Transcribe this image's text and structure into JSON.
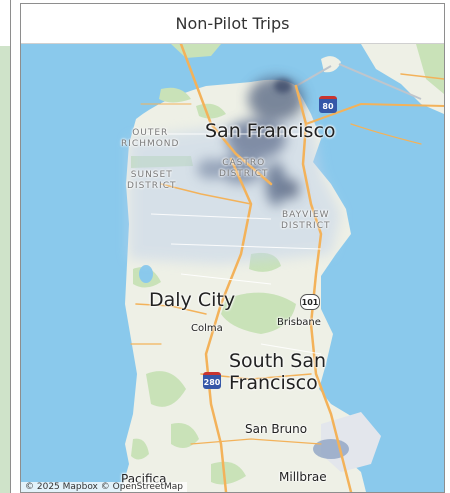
{
  "panel": {
    "title": "Non-Pilot Trips"
  },
  "map": {
    "labels": {
      "san_francisco": "San Francisco",
      "outer_richmond": "OUTER\nRICHMOND",
      "sunset_district": "SUNSET\nDISTRICT",
      "castro_district": "CASTRO\nDISTRICT",
      "bayview_district": "BAYVIEW\nDISTRICT",
      "daly_city": "Daly City",
      "colma": "Colma",
      "brisbane": "Brisbane",
      "south_san_francisco": "South San\nFrancisco",
      "san_bruno": "San Bruno",
      "pacifica": "Pacifica",
      "millbrae": "Millbrae"
    },
    "shields": {
      "i80": "80",
      "us101": "101",
      "i280": "280"
    },
    "attribution": "© 2025 Mapbox  © OpenStreetMap",
    "colors": {
      "water": "#8ac9ec",
      "land": "#eef0e6",
      "park": "#c9e2b8",
      "roads": "#f3b25a",
      "heat": "#4a5a7a"
    }
  }
}
